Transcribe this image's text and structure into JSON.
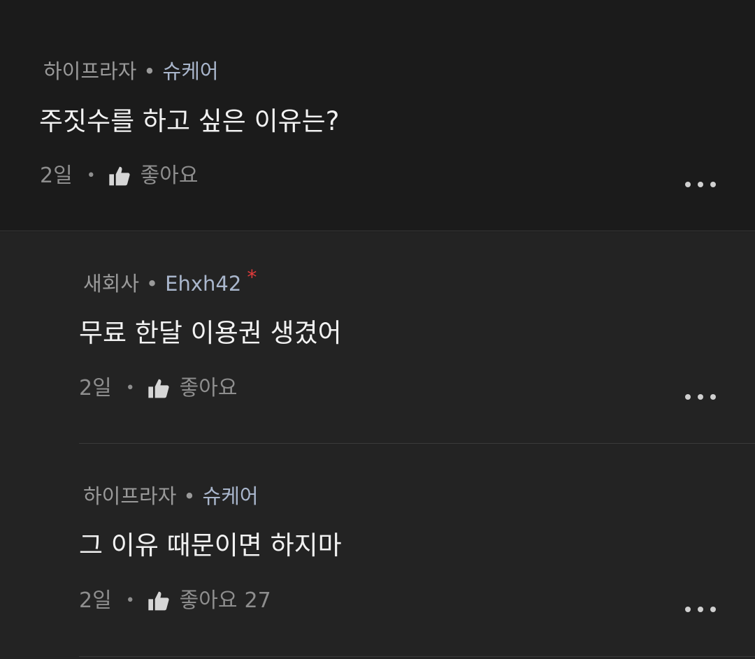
{
  "comments": [
    {
      "company": "하이프라자",
      "job": "슈케어",
      "text": "주짓수를 하고 싶은 이유는?",
      "time": "2일",
      "like_label": "좋아요",
      "like_count": "",
      "verified_mark": ""
    },
    {
      "company": "새회사",
      "job": "Ehxh42",
      "text": "무료 한달 이용권 생겼어",
      "time": "2일",
      "like_label": "좋아요",
      "like_count": "",
      "verified_mark": "*"
    },
    {
      "company": "하이프라자",
      "job": "슈케어",
      "text": "그 이유 때문이면 하지마",
      "time": "2일",
      "like_label": "좋아요",
      "like_count": "27",
      "verified_mark": ""
    }
  ],
  "separator": "•",
  "icons": {
    "like": "thumbs-up-icon",
    "more": "more-dots-icon"
  },
  "colors": {
    "background_top": "#1b1b1b",
    "background_replies": "#232323",
    "job_accent": "#a9b6cc",
    "asterisk": "#e23b3b"
  }
}
